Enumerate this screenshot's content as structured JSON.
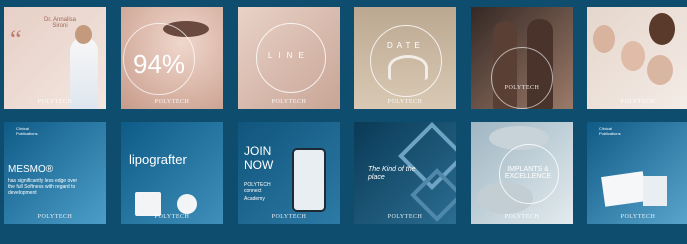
{
  "brand": "POLYTECH",
  "row1": [
    {
      "name": "quote",
      "text_a": "“",
      "text_b": "Dr. Annalisa Sironi",
      "colors": [
        "#e9d6cf",
        "#f3e6df"
      ]
    },
    {
      "name": "eye",
      "text_a": "94%",
      "colors": [
        "#cfa99a",
        "#e6cfc4"
      ]
    },
    {
      "name": "body-line",
      "text_a": "LINE",
      "colors": [
        "#dcb8aa",
        "#ecd7cd"
      ]
    },
    {
      "name": "yoga",
      "text_a": "DATE",
      "colors": [
        "#b9a690",
        "#d8c8b3"
      ]
    },
    {
      "name": "women",
      "colors": [
        "#3c2c27",
        "#8d6b5c"
      ]
    },
    {
      "name": "group",
      "colors": [
        "#d7c7bd",
        "#f1e7e0"
      ]
    }
  ],
  "row2": [
    {
      "name": "mesmo",
      "text_a": "Clinical Publications",
      "text_b": "MESMO®",
      "text_c": "has significantly less edge over the full Softness with regard to development",
      "colors": [
        "#0f5b87",
        "#4a9cc6"
      ]
    },
    {
      "name": "lipografter",
      "text_a": "lipografter",
      "colors": [
        "#0e5f8a",
        "#3f8fba"
      ]
    },
    {
      "name": "join-now",
      "text_a": "JOIN NOW",
      "text_b": "POLYTECH connect",
      "text_c": "Academy",
      "colors": [
        "#12577f",
        "#2d79a5"
      ]
    },
    {
      "name": "kind-of-place",
      "text_a": "The Kind of the place",
      "colors": [
        "#0b3d5b",
        "#2a6b8f"
      ]
    },
    {
      "name": "implants",
      "text_a": "IMPLANTS & EXCELLENCE",
      "colors": [
        "#9ab3bf",
        "#dde7ec"
      ]
    },
    {
      "name": "clinical-pubs",
      "text_a": "Clinical Publications",
      "colors": [
        "#0f5b87",
        "#5aa5cd"
      ]
    }
  ]
}
